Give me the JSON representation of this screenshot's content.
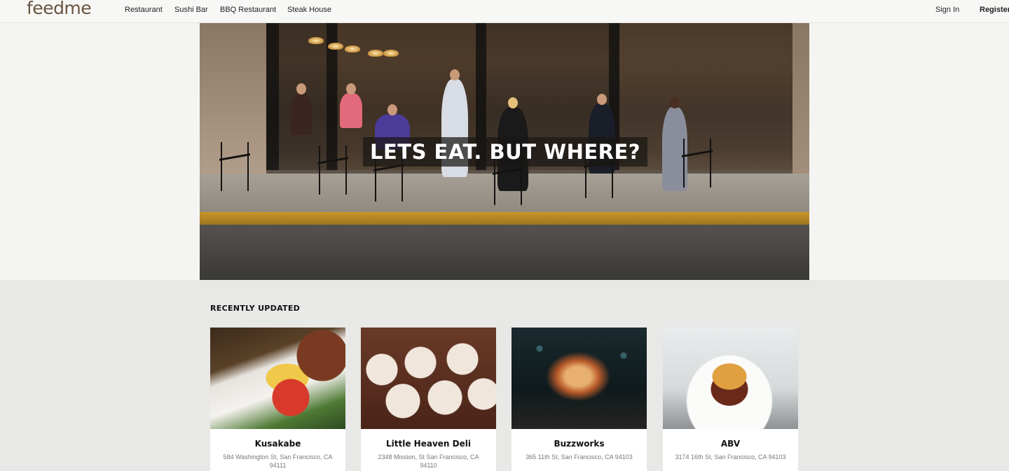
{
  "header": {
    "logo": "feedme",
    "nav": [
      {
        "label": "Restaurant"
      },
      {
        "label": "Sushi Bar"
      },
      {
        "label": "BBQ Restaurant"
      },
      {
        "label": "Steak House"
      }
    ],
    "sign_in": "Sign In",
    "register": "Register"
  },
  "hero": {
    "title": "LETS EAT. BUT WHERE?"
  },
  "recent": {
    "title": "RECENTLY UPDATED",
    "cards": [
      {
        "name": "Kusakabe",
        "address": "584 Washington St, San Francisco, CA 94111"
      },
      {
        "name": "Little Heaven Deli",
        "address": "2348 Mission, St San Francisco, CA 94110"
      },
      {
        "name": "Buzzworks",
        "address": "365 11th St, San Francisco, CA 94103"
      },
      {
        "name": "ABV",
        "address": "3174 16th St, San Francisco, CA 94103"
      }
    ]
  },
  "colors": {
    "logo": "#6b5540",
    "background": "#e8e8e6",
    "header_bg": "#f7f7f6"
  }
}
